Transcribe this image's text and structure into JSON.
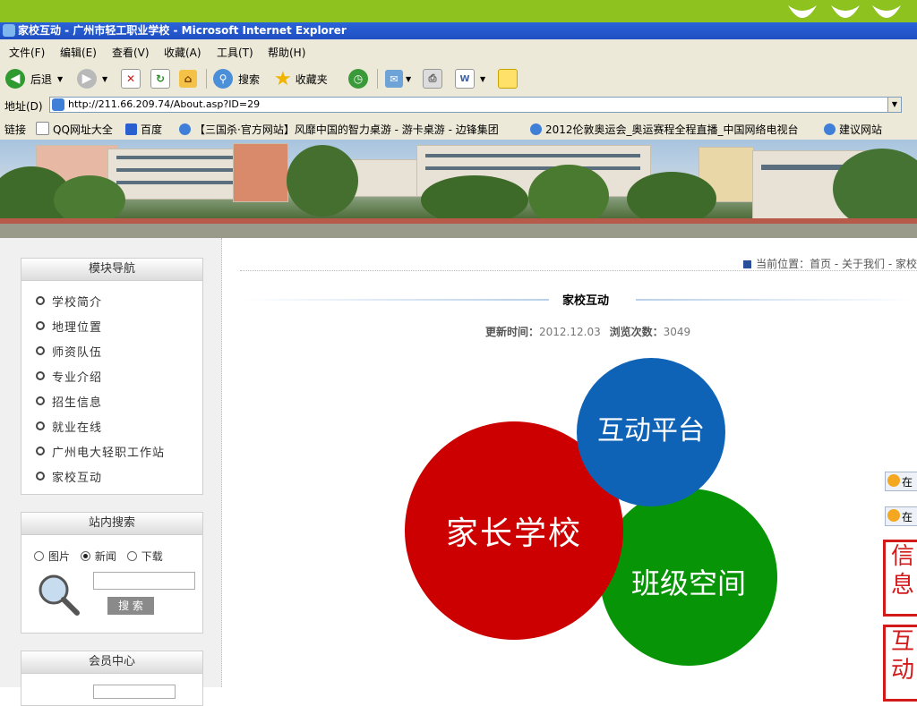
{
  "window": {
    "title": "家校互动 - 广州市轻工职业学校 - Microsoft Internet Explorer"
  },
  "menu": [
    "文件(F)",
    "编辑(E)",
    "查看(V)",
    "收藏(A)",
    "工具(T)",
    "帮助(H)"
  ],
  "toolbar": {
    "back": "后退",
    "search": "搜索",
    "favorites": "收藏夹"
  },
  "address": {
    "label": "地址(D)",
    "url": "http://211.66.209.74/About.asp?ID=29"
  },
  "links": {
    "label": "链接",
    "items": [
      "QQ网址大全",
      "百度",
      "【三国杀·官方网站】风靡中国的智力桌游 - 游卡桌游 - 边锋集团",
      "2012伦敦奥运会_奥运赛程全程直播_中国网络电视台",
      "建议网站"
    ]
  },
  "sidebar": {
    "nav_title": "模块导航",
    "nav_items": [
      "学校简介",
      "地理位置",
      "师资队伍",
      "专业介绍",
      "招生信息",
      "就业在线",
      "广州电大轻职工作站",
      "家校互动"
    ],
    "search_title": "站内搜索",
    "search_options": [
      "图片",
      "新闻",
      "下载"
    ],
    "search_selected": "新闻",
    "search_button": "搜 索",
    "member_title": "会员中心"
  },
  "content": {
    "breadcrumb": "当前位置：首页 - 关于我们 - 家校",
    "title": "家校互动",
    "update_label": "更新时间：",
    "update_value": "2012.12.03",
    "views_label": "浏览次数：",
    "views_value": "3049",
    "circles": {
      "red": "家长学校",
      "blue": "互动平台",
      "green": "班级空间"
    },
    "colors": {
      "red": "#cc0000",
      "blue": "#0f63b6",
      "green": "#079407"
    }
  },
  "edge": {
    "buttons": [
      "在",
      "在"
    ],
    "boxes": [
      "信息",
      "互动"
    ]
  }
}
